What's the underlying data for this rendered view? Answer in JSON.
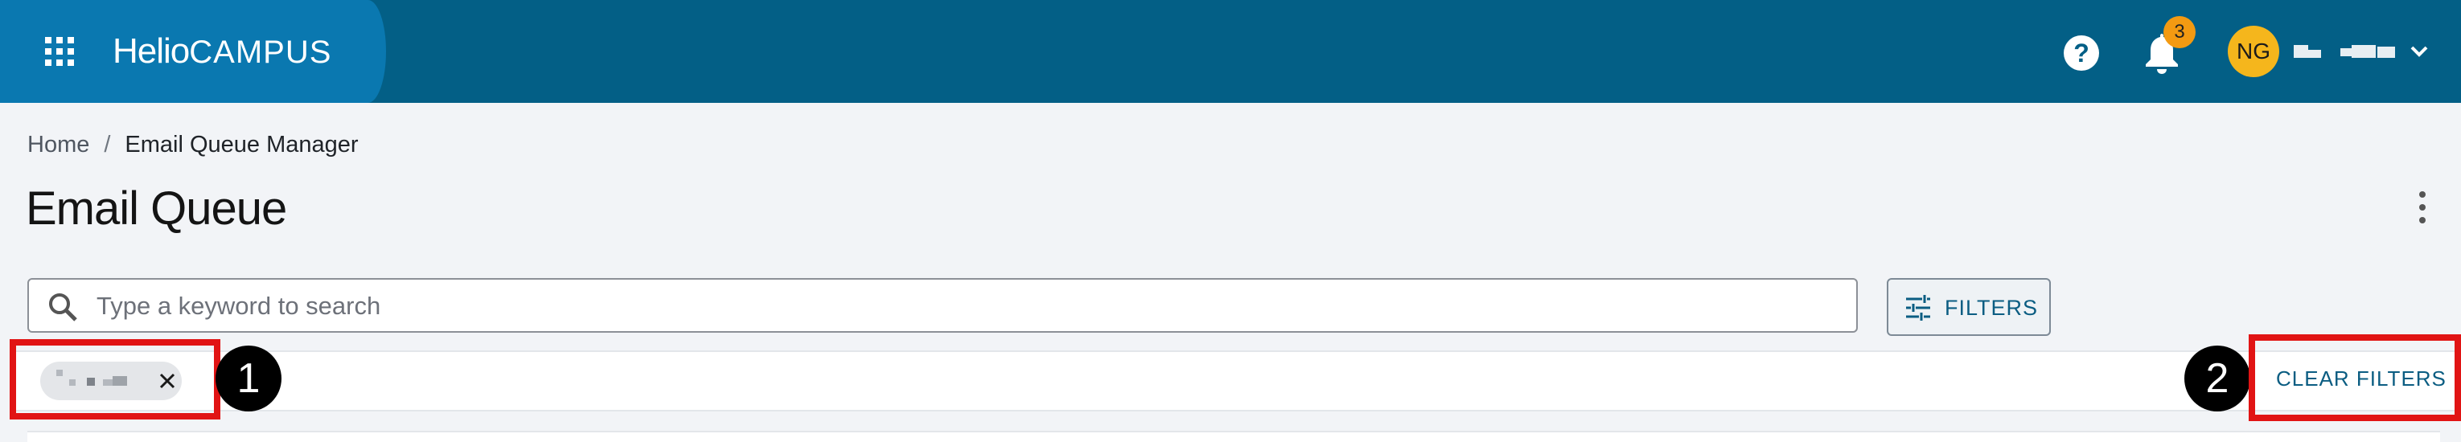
{
  "header": {
    "logo_text_a": "Helio",
    "logo_text_b": "CAMPUS",
    "help_icon": "?",
    "notifications_count": "3",
    "avatar_initials": "NG",
    "colors": {
      "bar": "#035f86",
      "brand_panel": "#0a78b0",
      "badge": "#f39a12",
      "avatar": "#f5b61c"
    },
    "icons": [
      "apps-grid-icon",
      "help-icon",
      "bell-icon",
      "chevron-down-icon"
    ]
  },
  "breadcrumb": {
    "home": "Home",
    "separator": "/",
    "current": "Email Queue Manager"
  },
  "page": {
    "title": "Email Queue"
  },
  "search": {
    "placeholder": "Type a keyword to search",
    "value": ""
  },
  "toolbar": {
    "filters_label": "FILTERS",
    "clear_filters_label": "CLEAR FILTERS"
  },
  "annotations": {
    "marker_1": "1",
    "marker_2": "2",
    "highlight_color": "#e11414"
  }
}
